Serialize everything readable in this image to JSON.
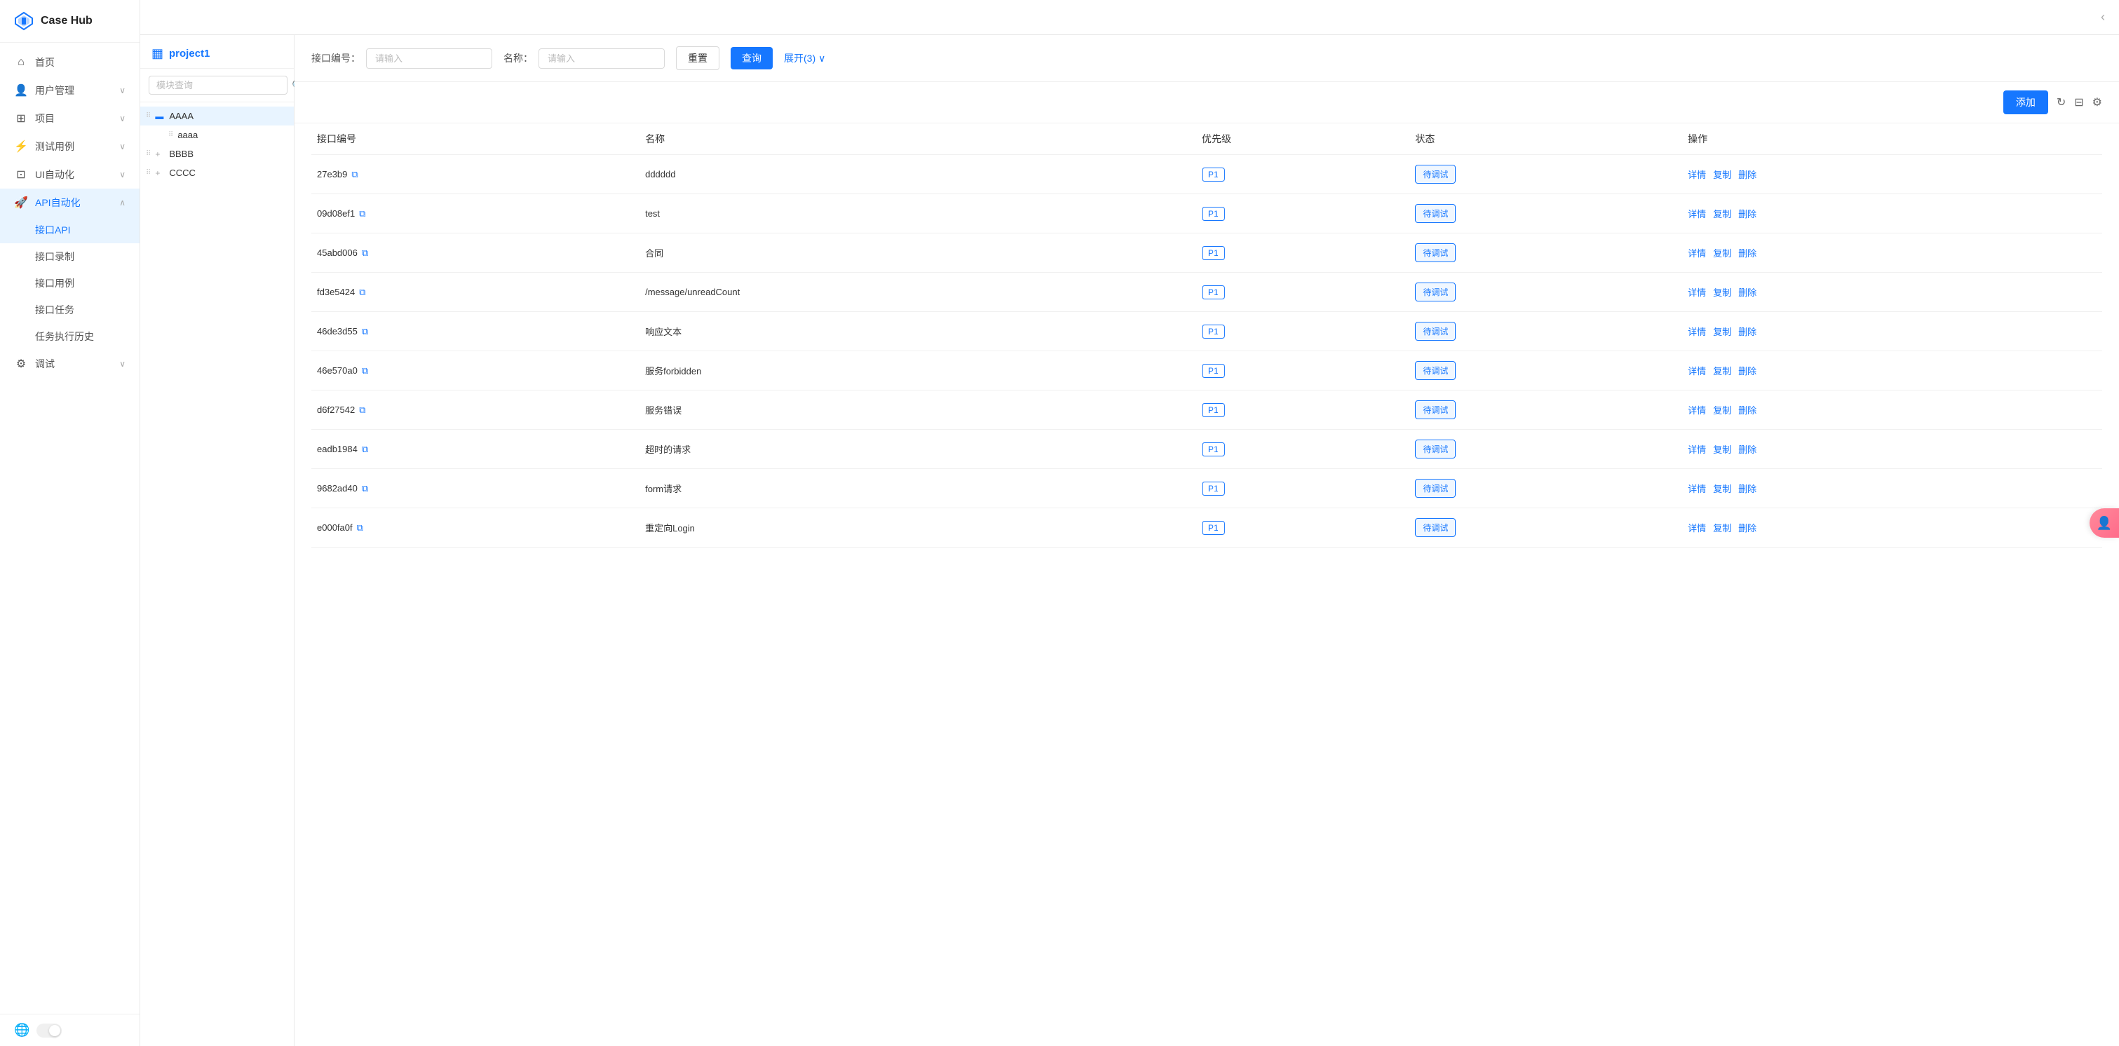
{
  "app": {
    "title": "Case Hub"
  },
  "sidebar": {
    "items": [
      {
        "id": "home",
        "icon": "⌂",
        "label": "首页",
        "hasArrow": false,
        "active": false
      },
      {
        "id": "user-mgmt",
        "icon": "👤",
        "label": "用户管理",
        "hasArrow": true,
        "active": false
      },
      {
        "id": "project",
        "icon": "⊞",
        "label": "项目",
        "hasArrow": true,
        "active": false
      },
      {
        "id": "test-case",
        "icon": "⚡",
        "label": "测试用例",
        "hasArrow": true,
        "active": false
      },
      {
        "id": "ui-auto",
        "icon": "⊡",
        "label": "UI自动化",
        "hasArrow": true,
        "active": false
      },
      {
        "id": "api-auto",
        "icon": "🚀",
        "label": "API自动化",
        "hasArrow": true,
        "active": true,
        "expanded": true
      }
    ],
    "api_sub_items": [
      {
        "id": "api-interface",
        "label": "接口API",
        "active": true
      },
      {
        "id": "api-record",
        "label": "接口录制",
        "active": false
      },
      {
        "id": "api-case",
        "label": "接口用例",
        "active": false
      },
      {
        "id": "api-task",
        "label": "接口任务",
        "active": false
      },
      {
        "id": "task-history",
        "label": "任务执行历史",
        "active": false
      }
    ],
    "debug_item": {
      "id": "debug",
      "icon": "⚙",
      "label": "调试",
      "hasArrow": true,
      "active": false
    }
  },
  "tree": {
    "project_icon": "▦",
    "project_title": "project1",
    "search_placeholder": "模块查询",
    "nodes": [
      {
        "id": "AAAA",
        "label": "AAAA",
        "expanded": true,
        "selected": true,
        "indent": 0
      },
      {
        "id": "aaaa",
        "label": "aaaa",
        "expanded": false,
        "selected": false,
        "indent": 1
      },
      {
        "id": "BBBB",
        "label": "BBBB",
        "expanded": false,
        "selected": false,
        "indent": 0
      },
      {
        "id": "CCCC",
        "label": "CCCC",
        "expanded": false,
        "selected": false,
        "indent": 0
      }
    ]
  },
  "filter": {
    "id_label": "接口编号：",
    "id_placeholder": "请输入",
    "name_label": "名称：",
    "name_placeholder": "请输入",
    "reset_label": "重置",
    "query_label": "查询",
    "expand_label": "展开(3)"
  },
  "toolbar": {
    "add_label": "添加",
    "refresh_icon": "refresh",
    "column_icon": "column",
    "settings_icon": "settings"
  },
  "table": {
    "columns": [
      "接口编号",
      "名称",
      "优先级",
      "状态",
      "操作"
    ],
    "rows": [
      {
        "id": "27e3b9",
        "name": "dddddd",
        "priority": "P1",
        "status": "待调试",
        "actions": [
          "详情",
          "复制",
          "删除"
        ]
      },
      {
        "id": "09d08ef1",
        "name": "test",
        "priority": "P1",
        "status": "待调试",
        "actions": [
          "详情",
          "复制",
          "删除"
        ]
      },
      {
        "id": "45abd006",
        "name": "合同",
        "priority": "P1",
        "status": "待调试",
        "actions": [
          "详情",
          "复制",
          "删除"
        ]
      },
      {
        "id": "fd3e5424",
        "name": "/message/unreadCount",
        "priority": "P1",
        "status": "待调试",
        "actions": [
          "详情",
          "复制",
          "删除"
        ]
      },
      {
        "id": "46de3d55",
        "name": "响应文本",
        "priority": "P1",
        "status": "待调试",
        "actions": [
          "详情",
          "复制",
          "删除"
        ]
      },
      {
        "id": "46e570a0",
        "name": "服务forbidden",
        "priority": "P1",
        "status": "待调试",
        "actions": [
          "详情",
          "复制",
          "删除"
        ]
      },
      {
        "id": "d6f27542",
        "name": "服务错误",
        "priority": "P1",
        "status": "待调试",
        "actions": [
          "详情",
          "复制",
          "删除"
        ]
      },
      {
        "id": "eadb1984",
        "name": "超时的请求",
        "priority": "P1",
        "status": "待调试",
        "actions": [
          "详情",
          "复制",
          "删除"
        ]
      },
      {
        "id": "9682ad40",
        "name": "form请求",
        "priority": "P1",
        "status": "待调试",
        "actions": [
          "详情",
          "复制",
          "删除"
        ]
      },
      {
        "id": "e000fa0f",
        "name": "重定向Login",
        "priority": "P1",
        "status": "待调试",
        "actions": [
          "详情",
          "复制",
          "删除"
        ]
      }
    ]
  }
}
